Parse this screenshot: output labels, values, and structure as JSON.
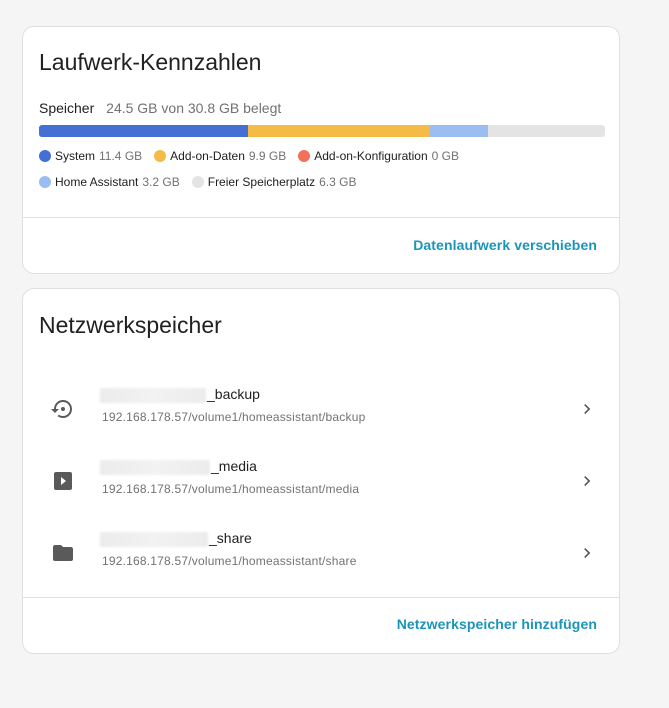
{
  "disk_card": {
    "title": "Laufwerk-Kennzahlen",
    "storage_label": "Speicher",
    "storage_usage": "24.5 GB von 30.8 GB belegt",
    "bar": [
      {
        "name": "System",
        "fraction": 0.37,
        "color": "#4470d6"
      },
      {
        "name": "Add-on-Daten",
        "fraction": 0.32,
        "color": "#f4bc46"
      },
      {
        "name": "Add-on-Konfiguration",
        "fraction": 0.0,
        "color": "#f2715a"
      },
      {
        "name": "Home Assistant",
        "fraction": 0.104,
        "color": "#9cbdf2"
      }
    ],
    "legend": [
      {
        "label": "System",
        "value": "11.4 GB",
        "color": "#4470d6"
      },
      {
        "label": "Add-on-Daten",
        "value": "9.9 GB",
        "color": "#f4bc46"
      },
      {
        "label": "Add-on-Konfiguration",
        "value": "0 GB",
        "color": "#f2715a"
      },
      {
        "label": "Home Assistant",
        "value": "3.2 GB",
        "color": "#9cbdf2"
      },
      {
        "label": "Freier Speicherplatz",
        "value": "6.3 GB",
        "color": "#e4e4e4"
      }
    ],
    "action": "Datenlaufwerk verschieben"
  },
  "network_card": {
    "title": "Netzwerkspeicher",
    "mounts": [
      {
        "icon": "backup-restore-icon",
        "name": "_backup",
        "path": "192.168.178.57/volume1/homeassistant/backup"
      },
      {
        "icon": "media-play-icon",
        "name": "_media",
        "path": "192.168.178.57/volume1/homeassistant/media"
      },
      {
        "icon": "folder-icon",
        "name": "_share",
        "path": "192.168.178.57/volume1/homeassistant/share"
      }
    ],
    "action": "Netzwerkspeicher hinzufügen"
  },
  "colors": {
    "accent": "#1a95b9",
    "icon": "#5a5a5a"
  }
}
